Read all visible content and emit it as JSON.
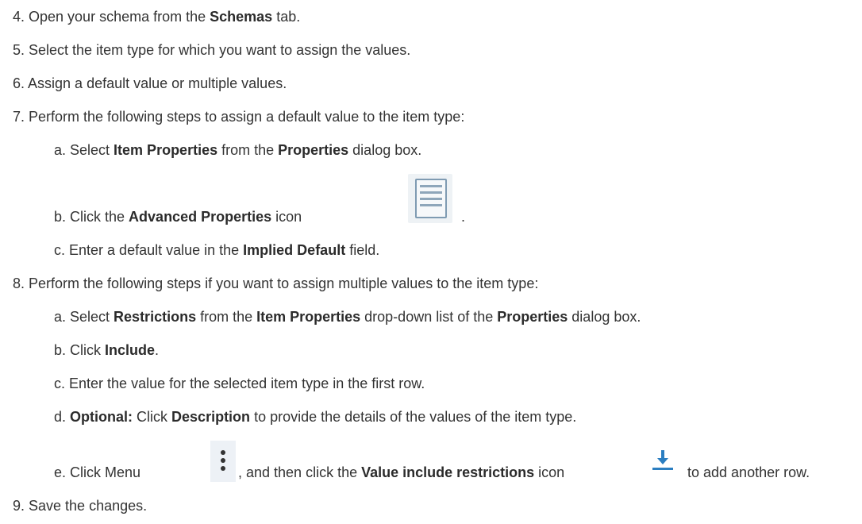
{
  "steps": [
    {
      "n": "4.",
      "t1": " Open your schema from the ",
      "b1": "Schemas",
      "t2": " tab."
    },
    {
      "n": "5.",
      "t1": " Select the item type for which you want to assign the values."
    },
    {
      "n": "6.",
      "t1": " Assign a default value or multiple values."
    },
    {
      "n": "7.",
      "t1": " Perform the following steps to assign a default value to the item type:"
    },
    {
      "n": "8.",
      "t1": " Perform the following steps if you want to assign multiple values to the item type:"
    },
    {
      "n": "9.",
      "t1": " Save the changes."
    }
  ],
  "sub7": [
    {
      "l": "a.",
      "t1": " Select ",
      "b1": "Item Properties",
      "t2": " from the ",
      "b2": "Properties",
      "t3": " dialog box."
    },
    {
      "l": "b.",
      "t1": " Click the ",
      "b1": "Advanced Properties",
      "t2": " icon",
      "t3": "."
    },
    {
      "l": "c.",
      "t1": " Enter a default value in the ",
      "b1": "Implied Default",
      "t2": " field."
    }
  ],
  "sub8": [
    {
      "l": "a.",
      "t1": " Select ",
      "b1": "Restrictions",
      "t2": " from the ",
      "b2": "Item Properties",
      "t3": " drop-down list of the ",
      "b3": "Properties",
      "t4": " dialog box."
    },
    {
      "l": "b.",
      "t1": " Click ",
      "b1": "Include",
      "t2": "."
    },
    {
      "l": "c.",
      "t1": " Enter the value for the selected item type in the first row."
    },
    {
      "l": "d.",
      "b1": "Optional:",
      "t1": "  Click ",
      "b2": "Description",
      "t2": " to provide the details of the values of the item type."
    },
    {
      "l": "e.",
      "t1": " Click Menu",
      "t2": ", and then click the ",
      "b1": "Value include restrictions",
      "t3": " icon",
      "t4": "to add another row."
    }
  ],
  "icons": {
    "advanced": "advanced-properties-icon",
    "menu": "menu-icon",
    "restriction": "value-include-restrictions-icon"
  },
  "colors": {
    "text": "#333333",
    "icon_blue": "#2b7ec1"
  }
}
